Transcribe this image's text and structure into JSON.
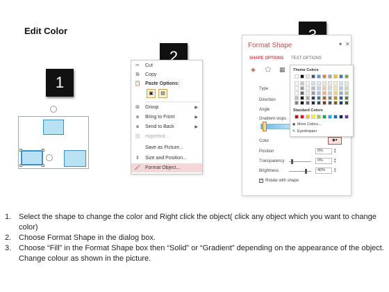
{
  "title": "Edit Color",
  "steps": {
    "one": "1",
    "two": "2",
    "three": "3"
  },
  "context_menu": {
    "items": [
      {
        "label": "Cut",
        "icon": "scissors-icon"
      },
      {
        "label": "Copy",
        "icon": "copy-icon"
      },
      {
        "label": "Paste Options:",
        "icon": "clipboard-icon"
      },
      {
        "label": "Group",
        "icon": "group-icon",
        "submenu": true
      },
      {
        "label": "Bring to Front",
        "icon": "bring-front-icon",
        "submenu": true
      },
      {
        "label": "Send to Back",
        "icon": "send-back-icon",
        "submenu": true
      },
      {
        "label": "Hyperlink...",
        "icon": "link-icon",
        "disabled": true
      },
      {
        "label": "Save as Picture...",
        "icon": ""
      },
      {
        "label": "Size and Position...",
        "icon": "size-icon"
      },
      {
        "label": "Format Object...",
        "icon": "format-icon",
        "highlight": true
      }
    ]
  },
  "format_pane": {
    "title": "Format Shape",
    "tab_shape": "SHAPE OPTIONS",
    "tab_text": "TEXT OPTIONS",
    "labels": {
      "type": "Type",
      "direction": "Direction",
      "angle": "Angle",
      "gradient_stops": "Gradient stops",
      "color": "Color",
      "position": "Position",
      "transparency": "Transparency",
      "brightness": "Brightness",
      "rotate": "Rotate with shape"
    },
    "values": {
      "position": "0%",
      "transparency": "0%",
      "brightness": "40%"
    }
  },
  "palette": {
    "theme_colors": "Theme Colors",
    "standard_colors": "Standard Colors",
    "more_colors": "More Colors...",
    "eyedropper": "Eyedropper",
    "theme_top": [
      "#ffffff",
      "#000000",
      "#e7e6e6",
      "#44546a",
      "#5b9bd5",
      "#ed7d31",
      "#a5a5a5",
      "#ffc000",
      "#4472c4",
      "#70ad47"
    ],
    "standard": [
      "#c00000",
      "#ff0000",
      "#ffc000",
      "#ffff00",
      "#92d050",
      "#00b050",
      "#00b0f0",
      "#0070c0",
      "#002060",
      "#7030a0"
    ]
  },
  "instructions": [
    {
      "num": "1.",
      "text": "Select the shape to change the color and Right click the object( click any object which you want to change color)"
    },
    {
      "num": "2.",
      "text": "Choose Format Shape in the dialog box."
    },
    {
      "num": "3.",
      "text": "Choose “Fill” in the Format Shape box then “Solid” or “Gradient” depending on the appearance of the object. Change colour as shown in the picture."
    }
  ],
  "colors": {
    "accent": "#c0504d",
    "shape_fill": "#b8e1f4",
    "shape_border": "#3a8fc6"
  }
}
